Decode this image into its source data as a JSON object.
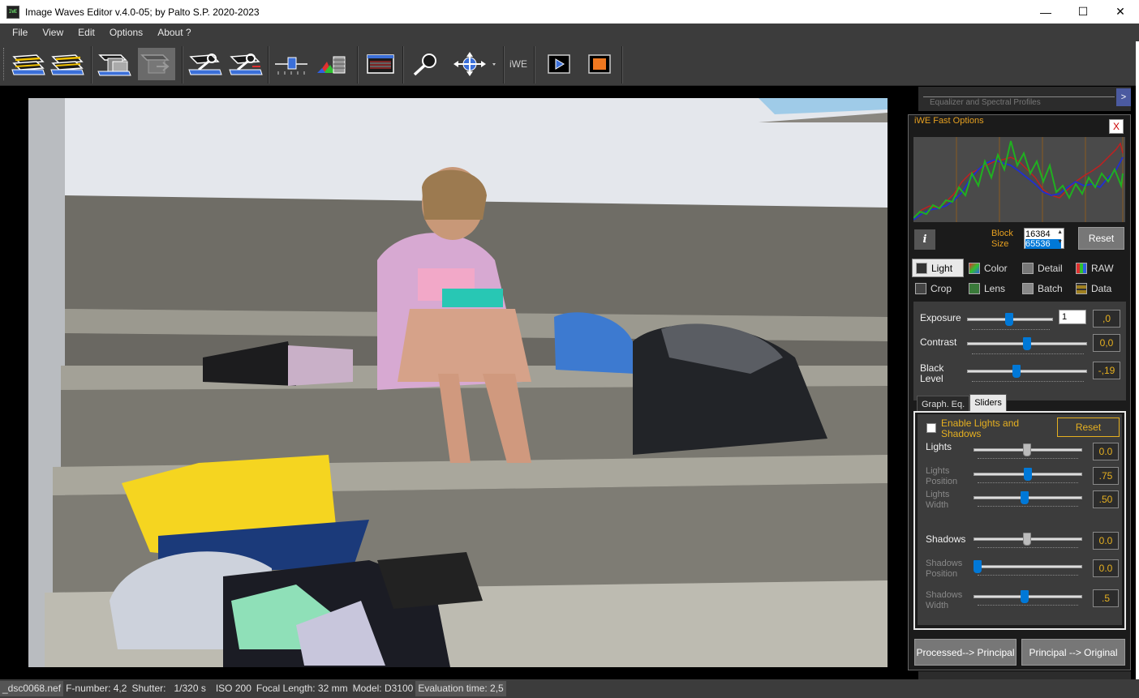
{
  "window": {
    "title": "Image Waves Editor  v.4.0-05; by Palto S.P.  2020-2023",
    "app_icon_text": "IWE",
    "minimize": "—",
    "maximize": "☐",
    "close": "✕"
  },
  "menu": {
    "file": "File",
    "view": "View",
    "edit": "Edit",
    "options": "Options",
    "about": "About ?"
  },
  "toolbar": {
    "iwe_label": "iWE"
  },
  "status": {
    "filename": "_dsc0068.nef",
    "fnumber": "F-number: 4,2",
    "shutter_label": "Shutter:",
    "shutter_value": "1/320 s",
    "iso": "ISO 200",
    "focal": "Focal Length: 32 mm",
    "model": "Model: D3100",
    "eval": "Evaluation time: 2,5"
  },
  "equalizer": {
    "label": "Equalizer and  Spectral Profiles",
    "expand": ">"
  },
  "panel": {
    "title": "iWE Fast Options",
    "close": "X",
    "info": "i",
    "block_label_1": "Block",
    "block_label_2": "Size",
    "block_value": "16384",
    "size_value": "65536",
    "reset": "Reset",
    "tabs": [
      "Light",
      "Color",
      "Detail",
      "RAW",
      "Crop",
      "Lens",
      "Batch",
      "Data"
    ],
    "exposure_label": "Exposure",
    "exposure_spinner": "1",
    "exposure_value": ",0",
    "contrast_label": "Contrast",
    "contrast_value": "0,0",
    "black_label_1": "Black",
    "black_label_2": "Level",
    "black_value": "-,19",
    "sub_tabs": [
      "Graph. Eq.",
      "Sliders"
    ],
    "enable_ls": "Enable Lights and Shadows",
    "ls_reset": "Reset",
    "lights": "Lights",
    "lights_value": "0.0",
    "lights_pos_1": "Lights",
    "lights_pos_2": "Position",
    "lights_pos_value": ".75",
    "lights_width_1": "Lights",
    "lights_width_2": "Width",
    "lights_width_value": ".50",
    "shadows": "Shadows",
    "shadows_value": "0.0",
    "shadows_pos_1": "Shadows",
    "shadows_pos_2": "Position",
    "shadows_pos_value": "0.0",
    "shadows_width_1": "Shadows",
    "shadows_width_2": "Width",
    "shadows_width_value": ".5",
    "btn_processed": "Processed--> Principal",
    "btn_principal": "Principal --> Original"
  },
  "colors": {
    "accent_orange": "#e6a020",
    "slider_blue": "#0078d7",
    "panel_bg": "#1b1b1b",
    "chrome_bg": "#3c3c3c"
  }
}
